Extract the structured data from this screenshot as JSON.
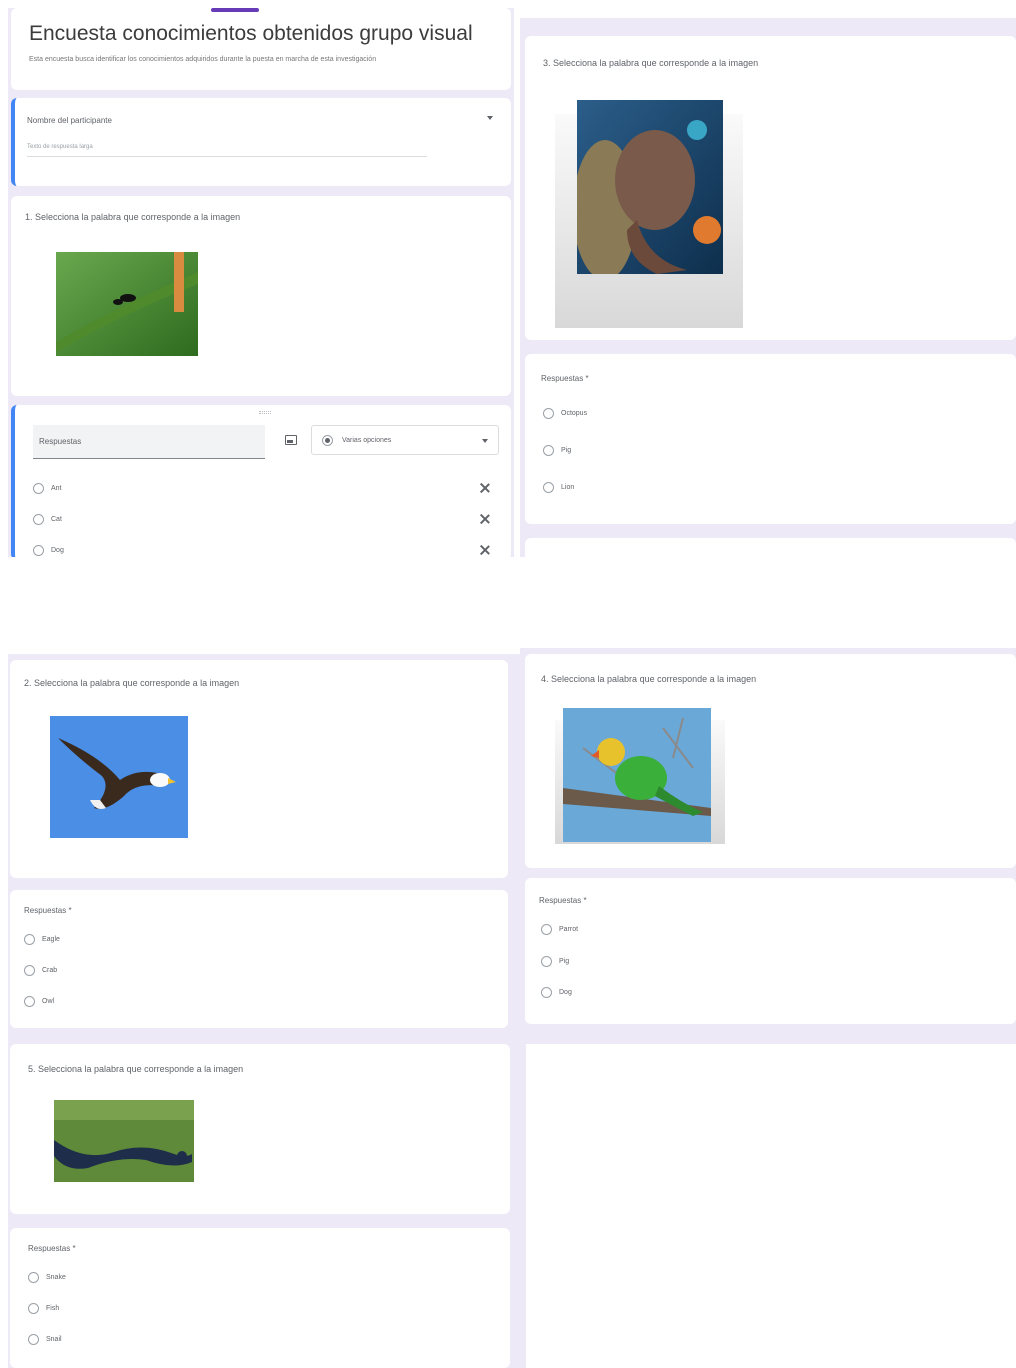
{
  "form": {
    "title": "Encuesta conocimientos obtenidos grupo visual",
    "description": "Esta encuesta busca identificar los conocimientos adquiridos durante la puesta en marcha de esta investigación"
  },
  "participant": {
    "label": "Nombre del participante",
    "placeholder": "Texto de respuesta larga"
  },
  "q1": {
    "text": "1. Selecciona la palabra que corresponde a la imagen",
    "answers_label": "Respuestas",
    "type_label": "Varias opciones",
    "options": [
      "Ant",
      "Cat",
      "Dog"
    ]
  },
  "q2": {
    "text": "2. Selecciona la palabra que corresponde a la imagen",
    "answers_label": "Respuestas",
    "required_mark": "*",
    "options": [
      "Eagle",
      "Crab",
      "Owl"
    ]
  },
  "q3": {
    "text": "3. Selecciona la palabra que corresponde a la imagen",
    "answers_label": "Respuestas",
    "required_mark": "*",
    "options": [
      "Octopus",
      "Pig",
      "Lion"
    ]
  },
  "q4": {
    "text": "4. Selecciona la palabra que corresponde a la imagen",
    "answers_label": "Respuestas",
    "required_mark": "*",
    "options": [
      "Parrot",
      "Pig",
      "Dog"
    ]
  },
  "q5": {
    "text": "5. Selecciona la palabra que corresponde a la imagen",
    "answers_label": "Respuestas",
    "required_mark": "*",
    "options": [
      "Snake",
      "Fish",
      "Snail"
    ]
  },
  "colors": {
    "panel_bg": "#ede9f6",
    "accent_purple": "#673ab7",
    "accent_blue": "#4285f4"
  }
}
